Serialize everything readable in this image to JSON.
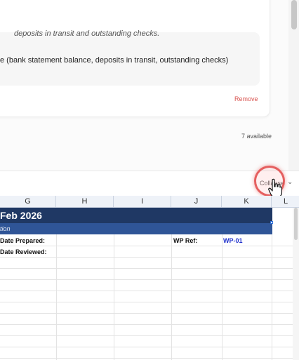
{
  "card": {
    "description": "deposits in transit and outstanding checks.",
    "inner_text": "e (bank statement balance, deposits in transit, outstanding checks)",
    "remove_label": "Remove"
  },
  "available_label": "7 available",
  "toolbar": {
    "collapse_label": "Collapse",
    "chevron": "⌄"
  },
  "sheet": {
    "columns": [
      "G",
      "H",
      "I",
      "J",
      "K",
      "L"
    ],
    "title": "Feb 2026",
    "subtitle": "tion",
    "rows": {
      "date_prepared_label": "Date Prepared:",
      "date_reviewed_label": "Date Reviewed:",
      "wp_ref_label": "WP Ref:",
      "wp_ref_value": "WP-01"
    }
  },
  "colors": {
    "title_bg": "#1f3864",
    "subtitle_bg": "#2f5597",
    "remove": "#d9534f",
    "wp_ref": "#2233cc"
  }
}
